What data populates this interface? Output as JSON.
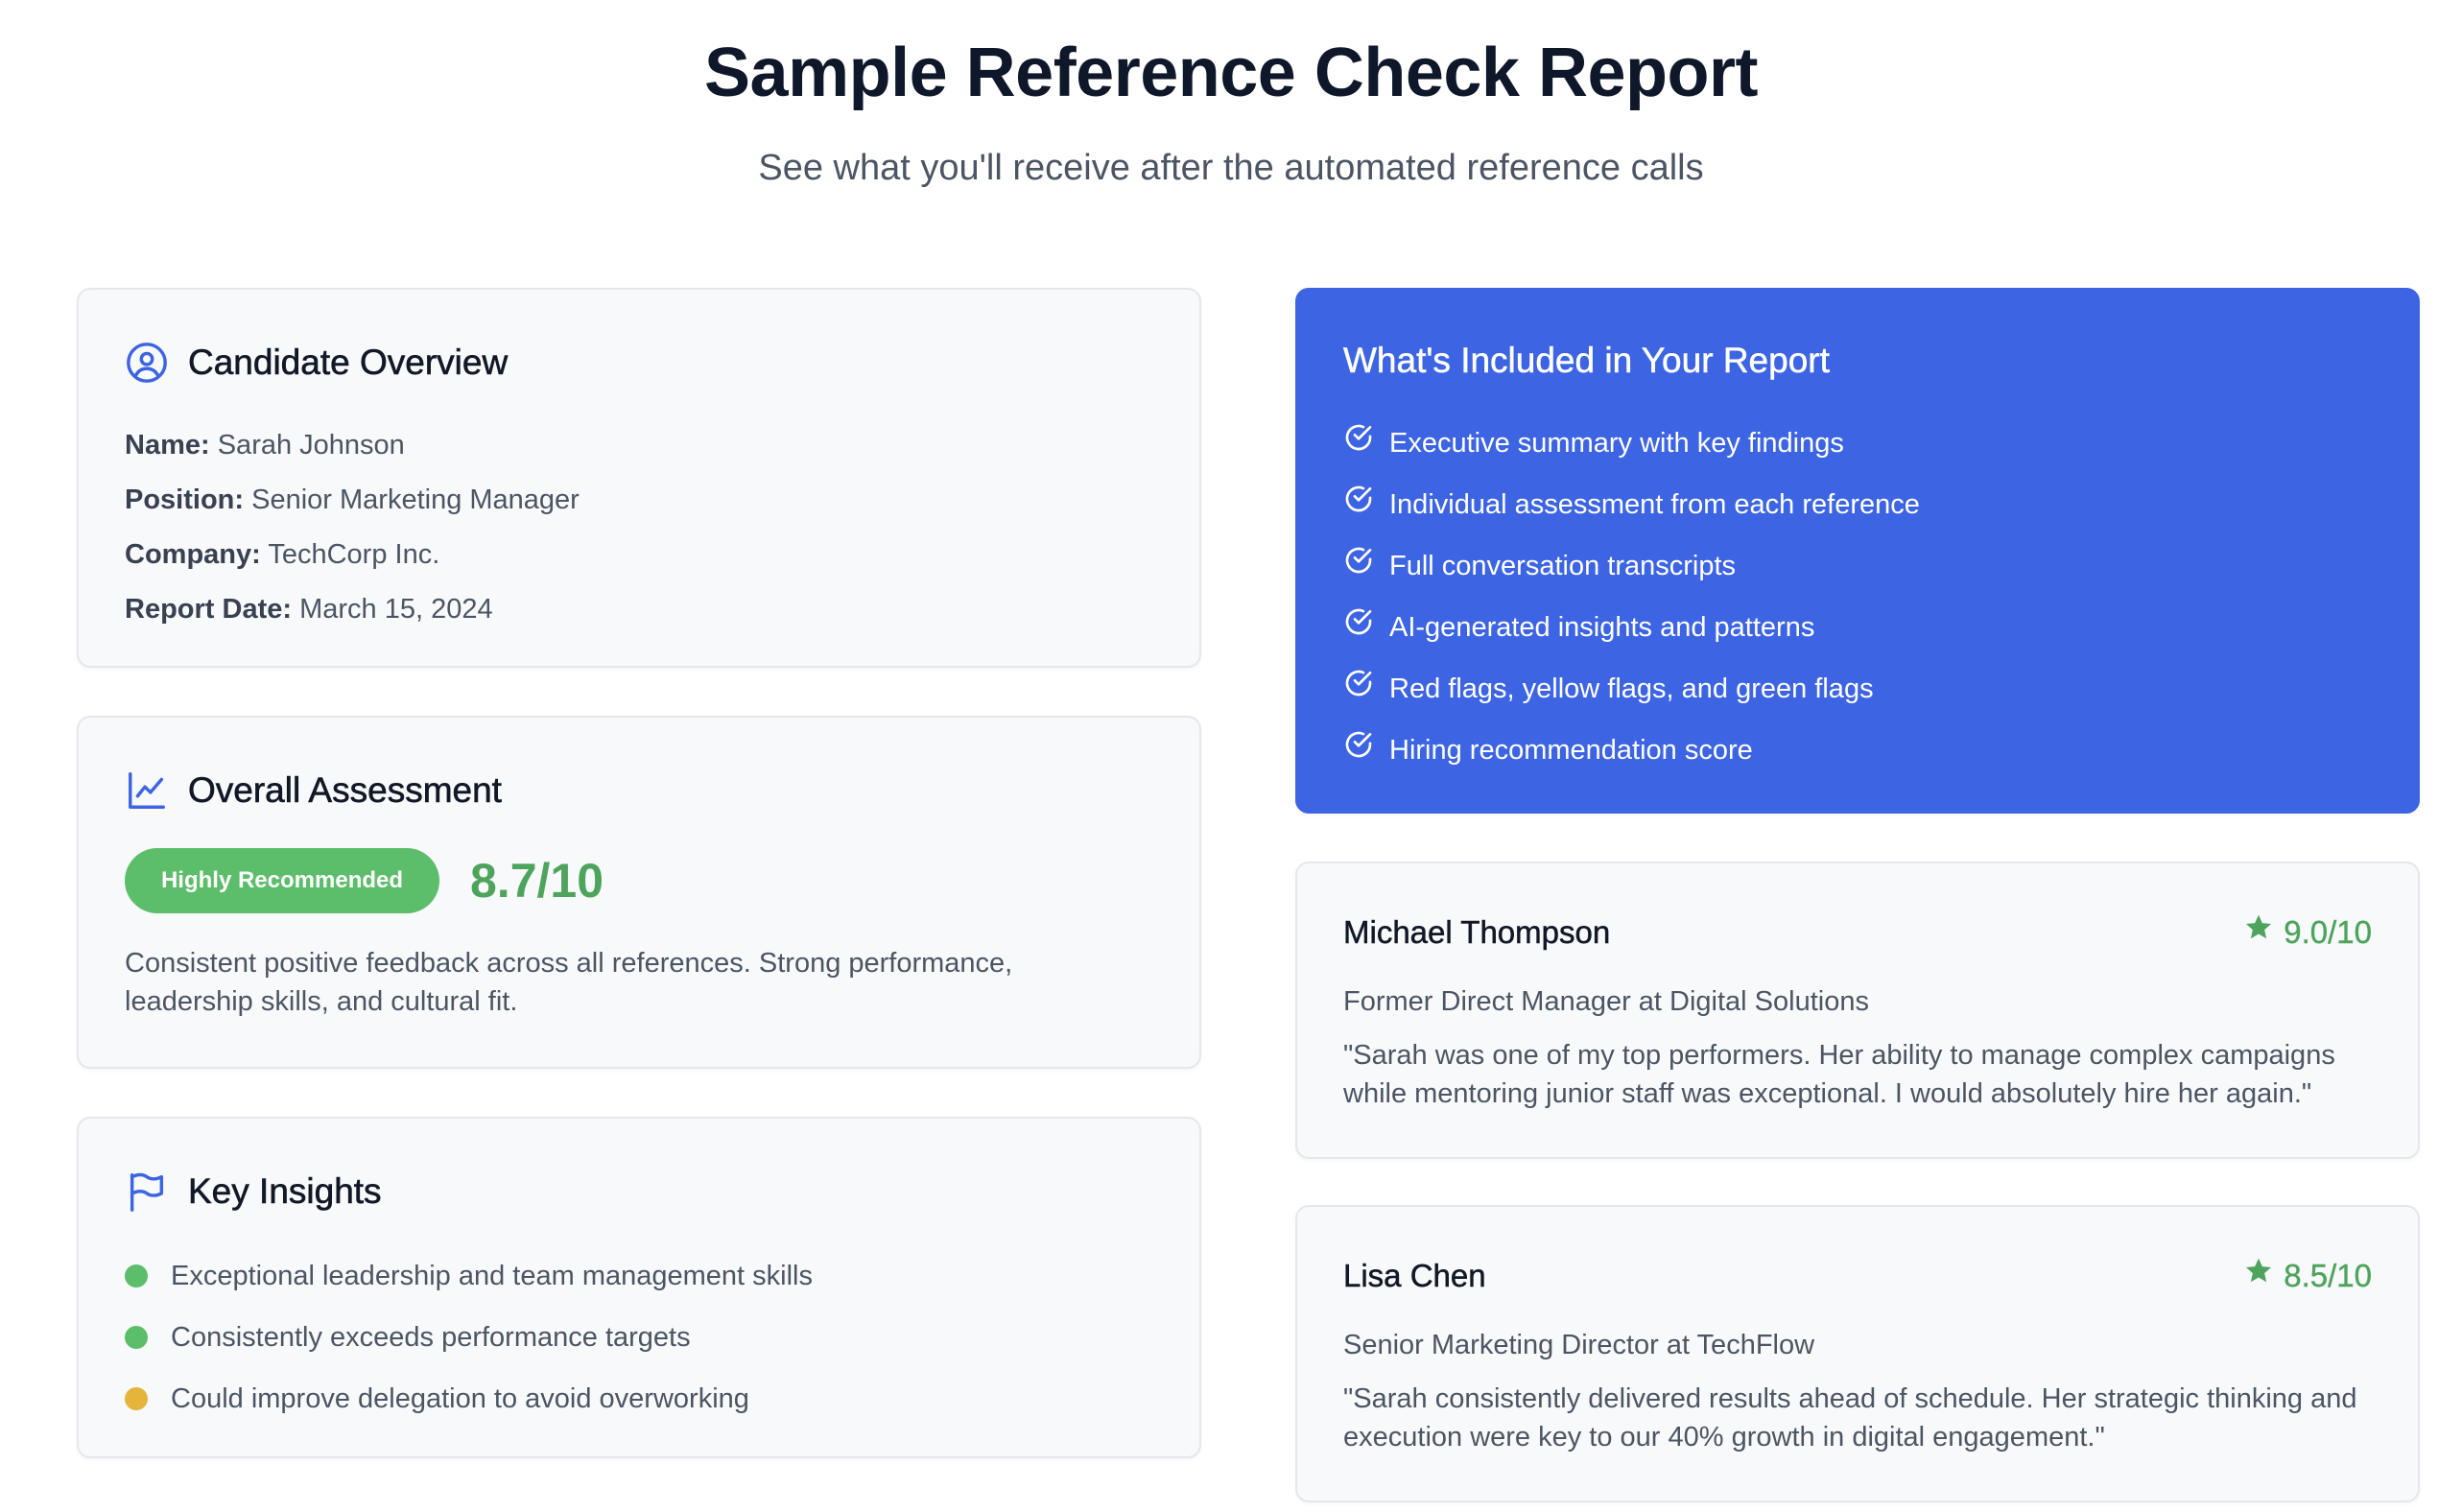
{
  "header": {
    "title": "Sample Reference Check Report",
    "subtitle": "See what you'll receive after the automated reference calls"
  },
  "overview": {
    "title": "Candidate Overview",
    "icon": "user-circle-icon",
    "fields": [
      {
        "label": "Name:",
        "value": "Sarah Johnson"
      },
      {
        "label": "Position:",
        "value": "Senior Marketing Manager"
      },
      {
        "label": "Company:",
        "value": "TechCorp Inc."
      },
      {
        "label": "Report Date:",
        "value": "March 15, 2024"
      }
    ]
  },
  "assessment": {
    "title": "Overall Assessment",
    "icon": "line-chart-icon",
    "badge": "Highly Recommended",
    "score": "8.7/10",
    "summary": "Consistent positive feedback across all references. Strong performance, leadership skills, and cultural fit."
  },
  "insights": {
    "title": "Key Insights",
    "icon": "flag-icon",
    "items": [
      {
        "text": "Exceptional leadership and team management skills",
        "color": "#5cbd6a"
      },
      {
        "text": "Consistently exceeds performance targets",
        "color": "#5cbd6a"
      },
      {
        "text": "Could improve delegation to avoid overworking",
        "color": "#e5b43a"
      }
    ]
  },
  "included": {
    "title": "What's Included in Your Report",
    "icon": "check-circle-icon",
    "items": [
      "Executive summary with key findings",
      "Individual assessment from each reference",
      "Full conversation transcripts",
      "AI-generated insights and patterns",
      "Red flags, yellow flags, and green flags",
      "Hiring recommendation score"
    ]
  },
  "references": [
    {
      "name": "Michael Thompson",
      "score": "9.0/10",
      "role": "Former Direct Manager at Digital Solutions",
      "quote": "\"Sarah was one of my top performers. Her ability to manage complex campaigns while mentoring junior staff was exceptional. I would absolutely hire her again.\""
    },
    {
      "name": "Lisa Chen",
      "score": "8.5/10",
      "role": "Senior Marketing Director at TechFlow",
      "quote": "\"Sarah consistently delivered results ahead of schedule. Her strategic thinking and execution were key to our 40% growth in digital engagement.\""
    }
  ],
  "colors": {
    "accent_blue": "#3d65e3",
    "success_green": "#5cbd6a",
    "score_green": "#4ea45c",
    "warning_yellow": "#e5b43a",
    "card_bg": "#f8f9fb",
    "card_border": "#e5e7eb"
  }
}
